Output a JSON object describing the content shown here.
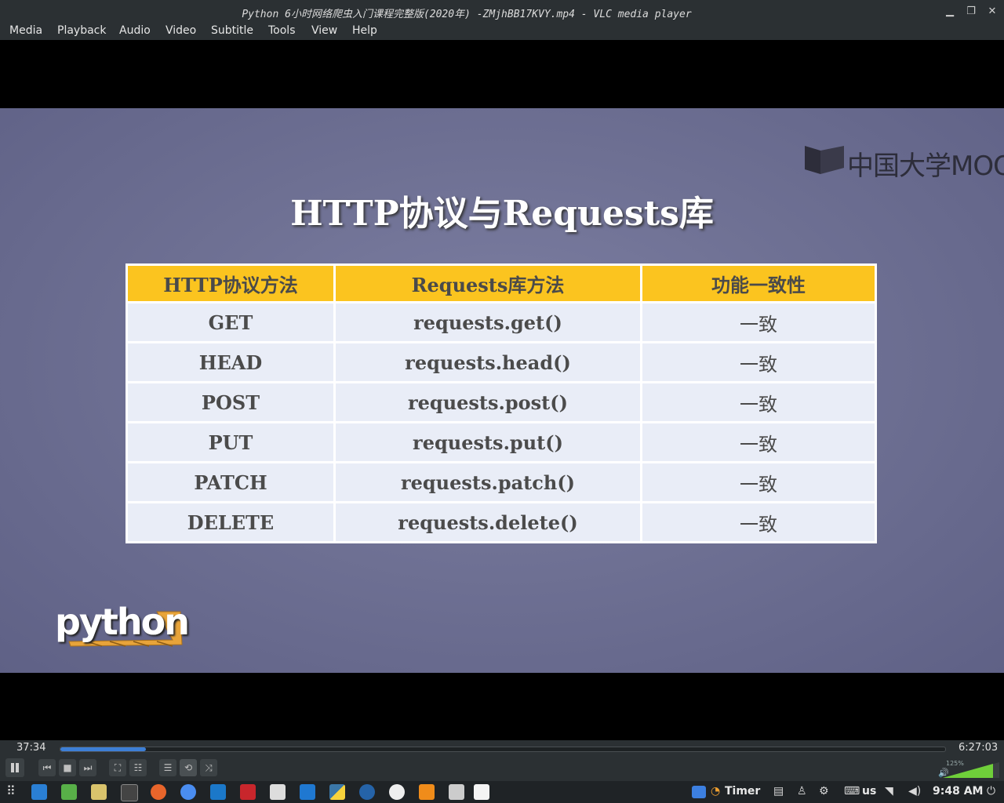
{
  "window": {
    "title": "Python 6小时网络爬虫入门课程完整版(2020年) -ZMjhBB17KVY.mp4 - VLC media player"
  },
  "menu": [
    {
      "label": "Media"
    },
    {
      "label": "Playback"
    },
    {
      "label": "Audio"
    },
    {
      "label": "Video"
    },
    {
      "label": "Subtitle"
    },
    {
      "label": "Tools"
    },
    {
      "label": "View"
    },
    {
      "label": "Help"
    }
  ],
  "slide": {
    "watermark": "中国大学MOOC",
    "title": "HTTP协议与Requests库",
    "headers": [
      "HTTP协议方法",
      "Requests库方法",
      "功能一致性"
    ],
    "rows": [
      [
        "GET",
        "requests.get()",
        "一致"
      ],
      [
        "HEAD",
        "requests.head()",
        "一致"
      ],
      [
        "POST",
        "requests.post()",
        "一致"
      ],
      [
        "PUT",
        "requests.put()",
        "一致"
      ],
      [
        "PATCH",
        "requests.patch()",
        "一致"
      ],
      [
        "DELETE",
        "requests.delete()",
        "一致"
      ]
    ],
    "logo_text": "python"
  },
  "playback": {
    "elapsed": "37:34",
    "total": "6:27:03",
    "progress_fraction": 0.097,
    "volume_label": "125%"
  },
  "taskbar": {
    "timer_label": "Timer",
    "keyboard_layout": "us",
    "clock": "9:48 AM"
  },
  "colors": {
    "header_bg": "#fbc41f",
    "accent": "#3d7fd6"
  }
}
